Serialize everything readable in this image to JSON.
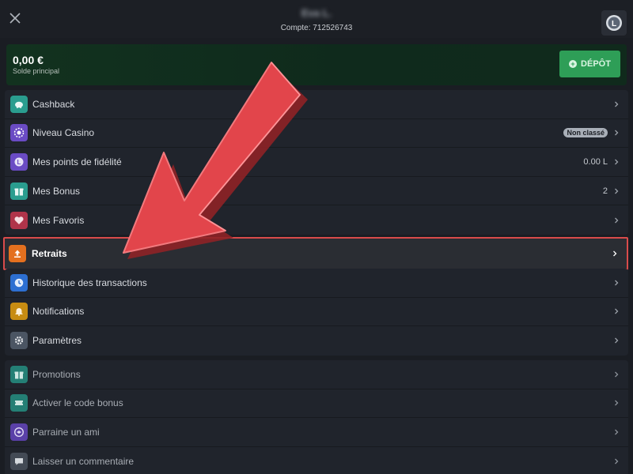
{
  "header": {
    "close_icon": "close-icon",
    "user_name": "Eva L.",
    "account_label": "Compte: 712526743",
    "avatar_icon": "loyalty-avatar-icon"
  },
  "balance": {
    "amount": "0,00 €",
    "label": "Solde principal",
    "deposit_label": "DÉPÔT",
    "deposit_icon": "plus-circle-icon"
  },
  "group1": {
    "items": [
      {
        "label": "Cashback",
        "icon": "piggy-bank-icon",
        "icon_color": "#2a9d8f"
      },
      {
        "label": "Niveau Casino",
        "icon": "casino-chip-icon",
        "icon_color": "#6a4bc4",
        "badge": "Non classé"
      },
      {
        "label": "Mes points de fidélité",
        "icon": "loyalty-coin-icon",
        "icon_color": "#6a4bc4",
        "value": "0.00 L"
      },
      {
        "label": "Mes Bonus",
        "icon": "gift-icon",
        "icon_color": "#2a9d8f",
        "value": "2"
      },
      {
        "label": "Mes Favoris",
        "icon": "heart-icon",
        "icon_color": "#b0344a"
      }
    ]
  },
  "highlighted": {
    "label": "Retraits",
    "icon": "upload-icon",
    "icon_color": "#e4701f"
  },
  "group2": {
    "items": [
      {
        "label": "Historique des transactions",
        "icon": "clock-icon",
        "icon_color": "#2d6fd1"
      },
      {
        "label": "Notifications",
        "icon": "bell-icon",
        "icon_color": "#c78c12"
      },
      {
        "label": "Paramètres",
        "icon": "gear-icon",
        "icon_color": "#4b5563"
      }
    ]
  },
  "group3": {
    "items": [
      {
        "label": "Promotions",
        "icon": "gift-icon",
        "icon_color": "#2a9d8f"
      },
      {
        "label": "Activer le code bonus",
        "icon": "ticket-icon",
        "icon_color": "#2a9d8f"
      },
      {
        "label": "Parraine un ami",
        "icon": "handshake-icon",
        "icon_color": "#6a4bc4"
      },
      {
        "label": "Laisser un commentaire",
        "icon": "chat-icon",
        "icon_color": "#4b5563"
      }
    ]
  },
  "overlay": {
    "arrow_color": "#e2454b"
  }
}
